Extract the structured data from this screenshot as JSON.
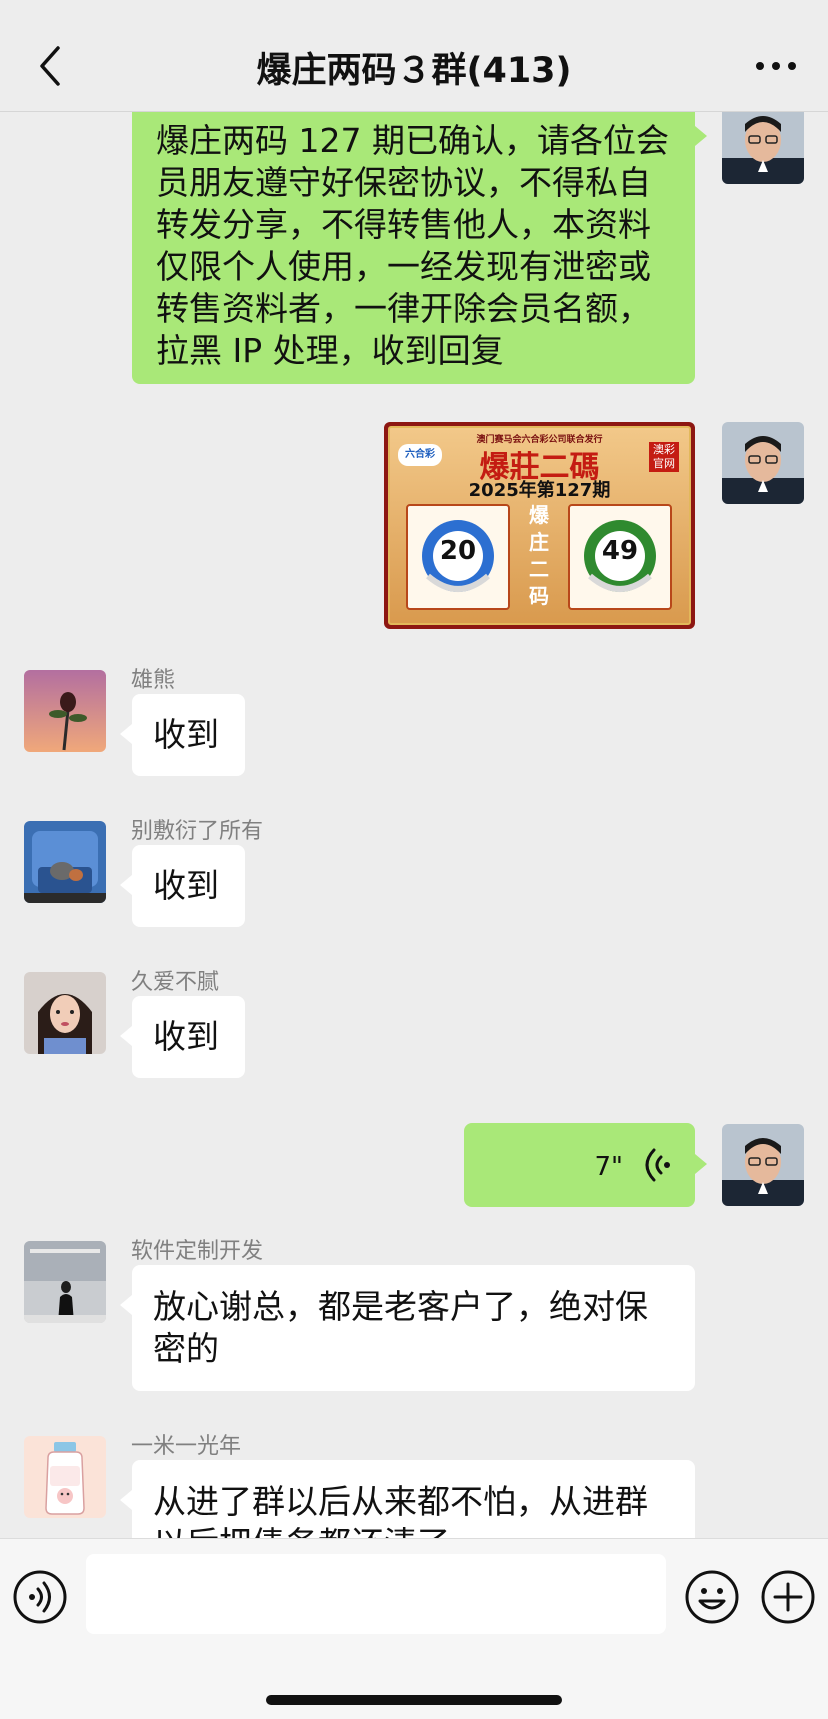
{
  "header": {
    "title": "爆庄两码３群(413)",
    "back_icon": "chevron-left-icon",
    "more_icon": "ellipsis-icon"
  },
  "messages": [
    {
      "sender": "",
      "type": "text",
      "from_me": true,
      "lines": [
        "爆庄两码 127 期已确认，请各位会",
        "员朋友遵守好保密协议，不得私自",
        "转发分享，不得转售他人，本资料",
        "仅限个人使用，一经发现有泄密或",
        "转售资料者，一律开除会员名额，",
        "拉黑 IP 处理，收到回复"
      ]
    },
    {
      "sender": "",
      "type": "image",
      "from_me": true,
      "poster": {
        "top_text": "澳门赛马会六合彩公司联合发行",
        "logo_text": "六合彩",
        "title": "爆莊二碼",
        "badge": "澳彩官网",
        "period": "2025年第127期",
        "middle_text": "爆庄二码",
        "numbers": [
          "20",
          "49"
        ]
      }
    },
    {
      "sender": "雄熊",
      "type": "text",
      "from_me": false,
      "text": "收到"
    },
    {
      "sender": "别敷衍了所有",
      "type": "text",
      "from_me": false,
      "text": "收到"
    },
    {
      "sender": "久爱不腻",
      "type": "text",
      "from_me": false,
      "text": "收到"
    },
    {
      "sender": "",
      "type": "voice",
      "from_me": true,
      "duration": "7\""
    },
    {
      "sender": "软件定制开发",
      "type": "text",
      "from_me": false,
      "lines": [
        "放心谢总，都是老客户了，绝对保",
        "密的"
      ]
    },
    {
      "sender": "一米一光年",
      "type": "text",
      "from_me": false,
      "lines": [
        "从进了群以后从来都不怕，从进群",
        "以后把债务都还清了"
      ]
    }
  ],
  "bottom_bar": {
    "voice_icon": "voice-input-icon",
    "emoji_icon": "emoji-icon",
    "plus_icon": "plus-icon",
    "input_value": ""
  },
  "colors": {
    "background": "#ededed",
    "my_bubble": "#a9e878",
    "other_bubble": "#ffffff",
    "poster_red": "#8d1712",
    "ball_blue": "#2c6fd1",
    "ball_green": "#2f8a2f"
  }
}
